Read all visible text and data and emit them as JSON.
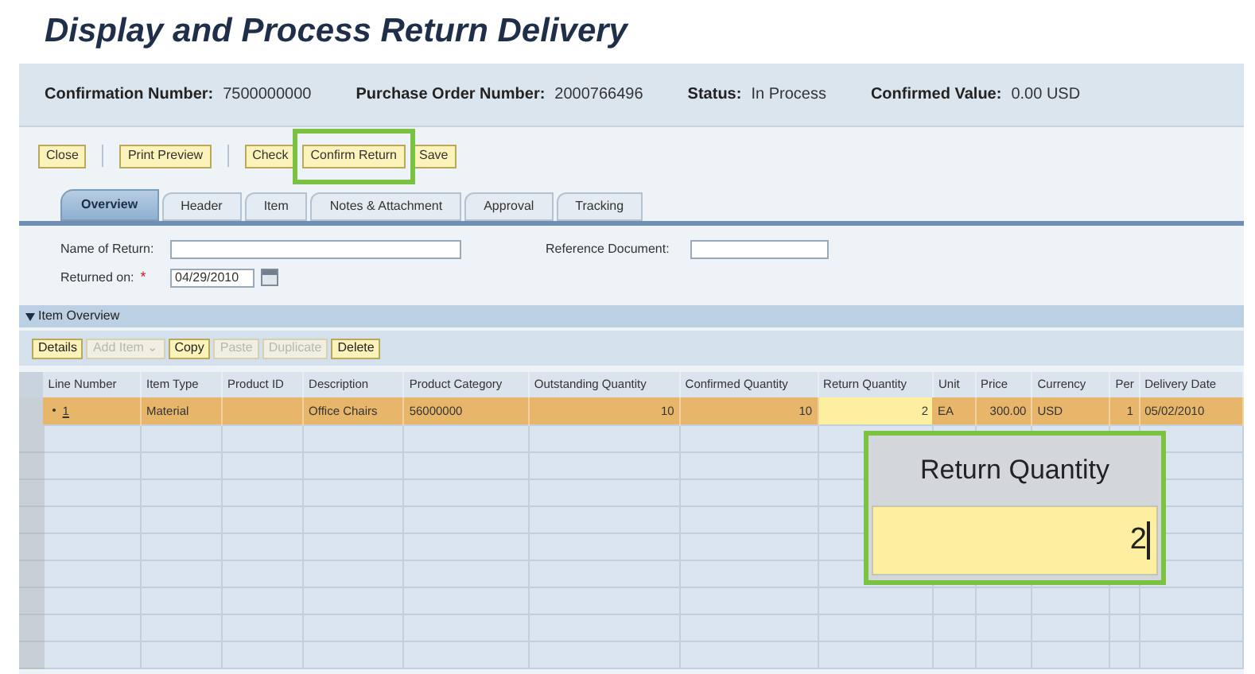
{
  "title": "Display and Process Return Delivery",
  "header_fields": [
    {
      "label": "Confirmation Number:",
      "value": "7500000000"
    },
    {
      "label": "Purchase Order Number:",
      "value": "2000766496"
    },
    {
      "label": "Status:",
      "value": "In Process"
    },
    {
      "label": "Confirmed Value:",
      "value": "0.00 USD"
    }
  ],
  "toolbar": [
    {
      "label": "Close",
      "highlighted": false
    },
    {
      "label": "Print Preview",
      "highlighted": false
    },
    {
      "label": "Check",
      "highlighted": false
    },
    {
      "label": "Confirm Return",
      "highlighted": true
    },
    {
      "label": "Save",
      "highlighted": false
    }
  ],
  "tabs": [
    {
      "label": "Overview",
      "selected": true
    },
    {
      "label": "Header",
      "selected": false
    },
    {
      "label": "Item",
      "selected": false
    },
    {
      "label": "Notes & Attachment",
      "selected": false
    },
    {
      "label": "Approval",
      "selected": false
    },
    {
      "label": "Tracking",
      "selected": false
    }
  ],
  "form": {
    "name_of_return": {
      "label": "Name of Return:"
    },
    "reference_document": {
      "label": "Reference Document:"
    },
    "returned_on": {
      "label": "Returned on:",
      "required_mark": "*",
      "value": "04/29/2010"
    }
  },
  "section": {
    "title": "Item Overview",
    "expanded": true
  },
  "item_toolbar": [
    {
      "label": "Details",
      "disabled": false
    },
    {
      "label": "Add Item ⌄",
      "disabled": true
    },
    {
      "label": "Copy",
      "disabled": false
    },
    {
      "label": "Paste",
      "disabled": true
    },
    {
      "label": "Duplicate",
      "disabled": true
    },
    {
      "label": "Delete",
      "disabled": false
    }
  ],
  "table": {
    "columns": [
      "Line Number",
      "Item Type",
      "Product ID",
      "Description",
      "Product Category",
      "Outstanding Quantity",
      "Confirmed Quantity",
      "Return Quantity",
      "Unit",
      "Price",
      "Currency",
      "Per",
      "Delivery Date"
    ],
    "rows": [
      {
        "selected": true,
        "cells": [
          "1",
          "Material",
          "",
          "Office Chairs",
          "56000000",
          "10",
          "10",
          "2",
          "EA",
          "300.00",
          "USD",
          "1",
          "05/02/2010"
        ]
      }
    ]
  },
  "callout": {
    "label": "Return Quantity",
    "value": "2"
  }
}
